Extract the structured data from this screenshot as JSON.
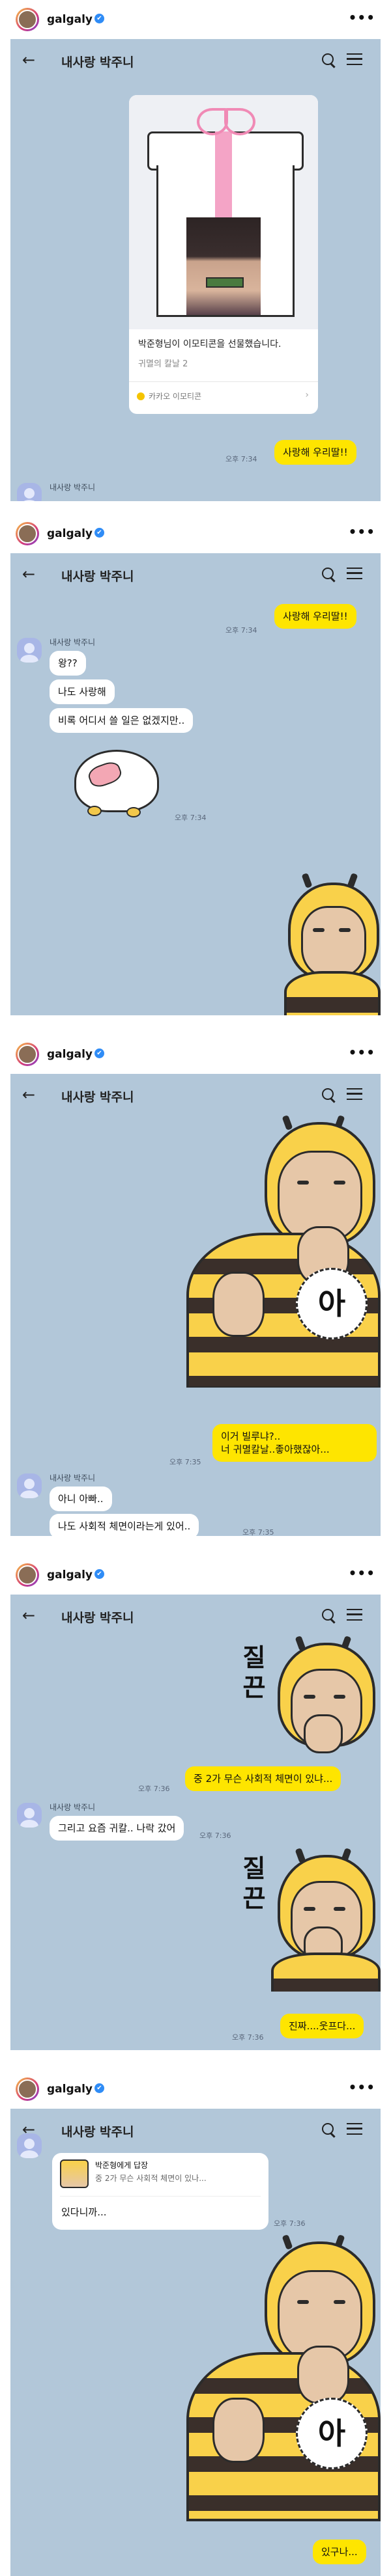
{
  "colors": {
    "chat_bg": "#b2c7d9",
    "my_bubble": "#fee500",
    "other_bubble": "#ffffff",
    "verified_badge": "#2f8cf6"
  },
  "icons": {
    "verified": "✔",
    "more": "•••",
    "back": "←",
    "search": "search-icon",
    "menu": "menu-icon",
    "chevron": "›"
  },
  "posts": [
    {
      "username": "galgaly",
      "room_title": "내사랑 박주니",
      "gift": {
        "text": "박준형님이 이모티콘을 선물했습니다.",
        "subtitle": "귀멸의 칼날 2",
        "footer": "카카오 이모티콘"
      },
      "messages": [
        {
          "time": "오후 7:34",
          "text": "사랑해 우리딸!!"
        }
      ],
      "sender": "내사랑 박주니"
    },
    {
      "username": "galgaly",
      "room_title": "내사랑 박주니",
      "messages": [
        {
          "text": "사랑해 우리딸!!",
          "time": "오후 7:34"
        },
        {
          "text": "왕??"
        },
        {
          "text": "나도 사랑해"
        },
        {
          "text": "비록 어디서 쓸 일은 없겠지만.."
        },
        {
          "time": "오후 7:34"
        }
      ],
      "sender": "내사랑 박주니"
    },
    {
      "username": "galgaly",
      "room_title": "내사랑 박주니",
      "sticker_text": "아",
      "messages": [
        {
          "text_line1": "이거 빌루냐?..",
          "text_line2": "너 귀멸칼날..좋아했잖아...",
          "time": "오후 7:35"
        },
        {
          "text": "아니 아빠.."
        },
        {
          "text": "나도 사회적 체면이라는게 있어..",
          "time": "오후 7:35"
        }
      ],
      "sender": "내사랑 박주니"
    },
    {
      "username": "galgaly",
      "room_title": "내사랑 박주니",
      "sticker_text_1": "질끈",
      "sticker_text_2": "질끈",
      "messages": [
        {
          "text": "중 2가 무슨 사회적 체면이 있냐...",
          "time": "오후 7:36"
        },
        {
          "text": "그리고 요즘 귀칼.. 나락 갔어",
          "time": "오후 7:36"
        },
        {
          "text": "진짜....웃프다...",
          "time": "오후 7:36"
        }
      ],
      "sender": "내사랑 박주니"
    },
    {
      "username": "galgaly",
      "room_title": "내사랑 박주니",
      "sticker_text": "아",
      "quote": {
        "name": "박준형에게 답장",
        "text": "중 2가 무슨 사회적 체면이 있나...",
        "body": "있다니까..."
      },
      "messages": [
        {
          "time": "오후 7:36"
        },
        {
          "text": "있구나..."
        }
      ]
    }
  ]
}
